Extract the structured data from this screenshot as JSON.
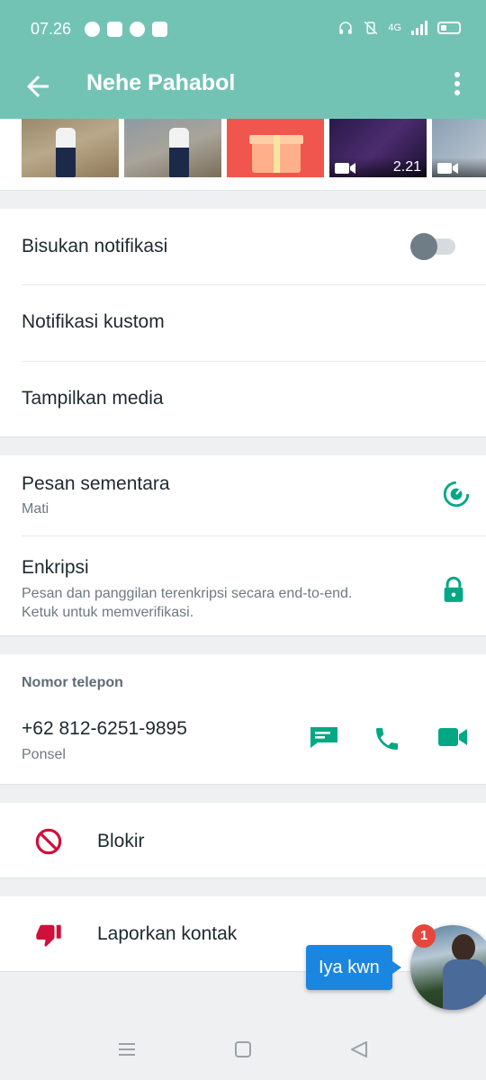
{
  "status_bar": {
    "time": "07.26",
    "network": "4G"
  },
  "app_bar": {
    "title": "Nehe Pahabol",
    "back_icon": "arrow-left-icon",
    "more_icon": "more-vertical-icon"
  },
  "media": {
    "thumbnails": [
      {
        "kind": "photo"
      },
      {
        "kind": "photo"
      },
      {
        "kind": "photo"
      },
      {
        "kind": "video",
        "duration": "2.21"
      },
      {
        "kind": "video",
        "duration": ""
      }
    ]
  },
  "settings": {
    "mute_label": "Bisukan notifikasi",
    "mute_on": false,
    "custom_notif_label": "Notifikasi kustom",
    "media_visibility_label": "Tampilkan media"
  },
  "privacy": {
    "disappearing_label": "Pesan sementara",
    "disappearing_value": "Mati",
    "encryption_label": "Enkripsi",
    "encryption_desc_1": "Pesan dan panggilan terenkripsi secara end-to-end.",
    "encryption_desc_2": "Ketuk untuk memverifikasi."
  },
  "phone_section": {
    "title": "Nomor telepon",
    "number": "+62 812-6251-9895",
    "type": "Ponsel"
  },
  "actions": {
    "block_label": "Blokir",
    "report_label": "Laporkan kontak"
  },
  "chat_head": {
    "message": "Iya kwn",
    "unread_count": "1"
  },
  "colors": {
    "primary": "#73c3b5",
    "accent_green": "#00a884",
    "danger": "#d0103a",
    "bubble": "#1b86e0"
  }
}
